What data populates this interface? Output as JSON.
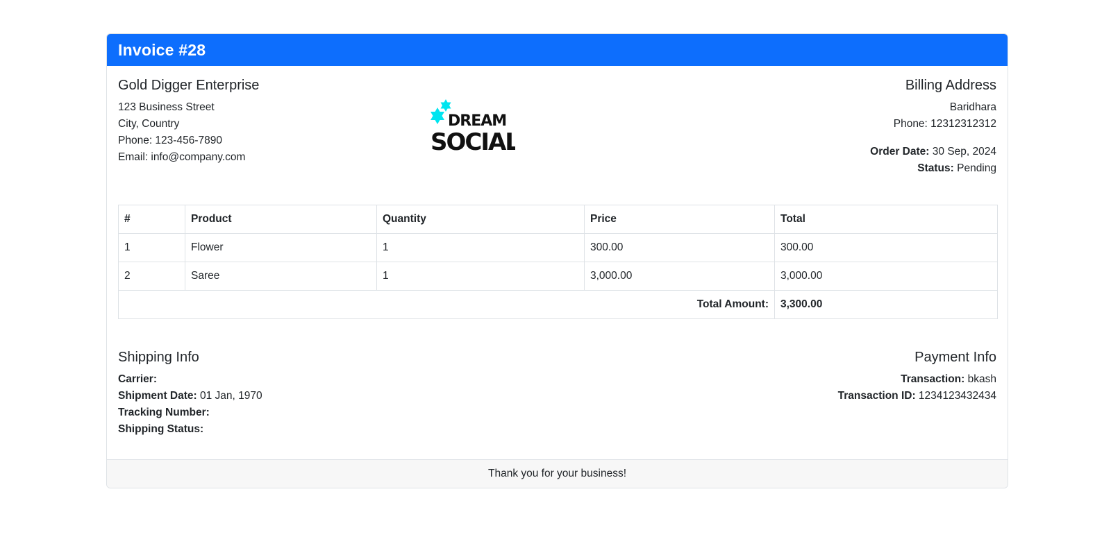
{
  "invoice": {
    "title": "Invoice #28"
  },
  "company": {
    "name": "Gold Digger Enterprise",
    "street": "123 Business Street",
    "city": "City, Country",
    "phone": "Phone: 123-456-7890",
    "email": "Email: info@company.com"
  },
  "logo": {
    "line1": "DREAM",
    "line2": "SOCIAL",
    "accent_color": "#00e5f0"
  },
  "billing": {
    "heading": "Billing Address",
    "name": "Baridhara",
    "phone": "Phone: 12312312312",
    "order_date_label": "Order Date:",
    "order_date": "30 Sep, 2024",
    "status_label": "Status:",
    "status": "Pending"
  },
  "table": {
    "headers": [
      "#",
      "Product",
      "Quantity",
      "Price",
      "Total"
    ],
    "rows": [
      [
        "1",
        "Flower",
        "1",
        "300.00",
        "300.00"
      ],
      [
        "2",
        "Saree",
        "1",
        "3,000.00",
        "3,000.00"
      ]
    ],
    "total_label": "Total Amount:",
    "total_value": "3,300.00"
  },
  "shipping": {
    "heading": "Shipping Info",
    "carrier_label": "Carrier:",
    "carrier": "",
    "shipment_date_label": "Shipment Date:",
    "shipment_date": "01 Jan, 1970",
    "tracking_label": "Tracking Number:",
    "tracking": "",
    "status_label": "Shipping Status:",
    "status": ""
  },
  "payment": {
    "heading": "Payment Info",
    "transaction_label": "Transaction:",
    "transaction": "bkash",
    "transaction_id_label": "Transaction ID:",
    "transaction_id": "1234123432434"
  },
  "footer": {
    "text": "Thank you for your business!"
  },
  "colors": {
    "header_bg": "#0d6efd",
    "footer_bg": "#f7f7f7"
  }
}
